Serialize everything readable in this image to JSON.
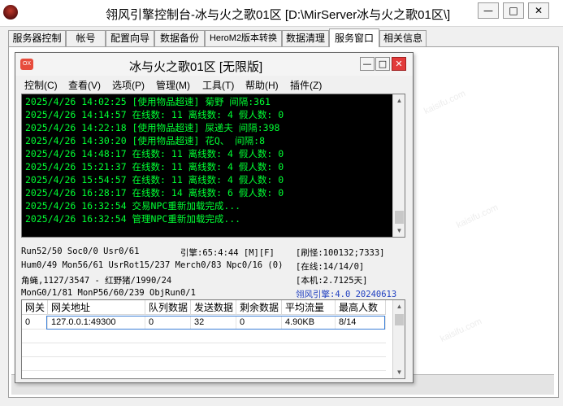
{
  "window": {
    "title": "翎风引擎控制台-冰与火之歌01区 [D:\\MirServer冰与火之歌01区\\]",
    "controls": [
      "—",
      "□",
      "✕"
    ]
  },
  "tabs": [
    {
      "label": "服务器控制",
      "active": false
    },
    {
      "label": "帐号",
      "active": false
    },
    {
      "label": "配置向导",
      "active": false
    },
    {
      "label": "数据备份",
      "active": false
    },
    {
      "label": "HeroM2版本转换",
      "active": false
    },
    {
      "label": "数据清理",
      "active": false
    },
    {
      "label": "服务窗口",
      "active": true
    },
    {
      "label": "相关信息",
      "active": false
    }
  ],
  "inner_window": {
    "icon_text": "OX",
    "title": "冰与火之歌01区 [无限版]",
    "controls": [
      "—",
      "□",
      "✕"
    ],
    "menu": [
      "控制(C)",
      "查看(V)",
      "选项(P)",
      "管理(M)",
      "工具(T)",
      "帮助(H)",
      "插件(Z)"
    ]
  },
  "log": [
    "2025/4/26 14:02:25 [使用物品超速] 菊野 间隔:361",
    "2025/4/26 14:14:57 在线数: 11 离线数: 4 假人数: 0",
    "2025/4/26 14:22:18 [使用物品超速] 屎递夫 间隔:398",
    "2025/4/26 14:30:20 [使用物品超速] 花Q、 间隔:8",
    "2025/4/26 14:48:17 在线数: 11 离线数: 4 假人数: 0",
    "2025/4/26 15:21:37 在线数: 11 离线数: 4 假人数: 0",
    "2025/4/26 15:54:57 在线数: 11 离线数: 4 假人数: 0",
    "2025/4/26 16:28:17 在线数: 14 离线数: 6 假人数: 0",
    "2025/4/26 16:32:54 交易NPC重新加载完成...",
    "2025/4/26 16:32:54 管理NPC重新加载完成..."
  ],
  "status": {
    "line1": "Run52/50 Soc0/0 Usr0/61",
    "line1_mid": "引擎:65:4:44 [M][F]",
    "line1_right": "[刷怪:100132;7333]",
    "line2": "Hum0/49 Mon56/61 UsrRot15/237 Merch0/83 Npc0/16 (0)",
    "line2_right": "[在线:14/14/0]",
    "line3": "角蝇,1127/3547 - 红野猪/1990/24",
    "line3_right": "[本机:2.7125天]",
    "line4": "MonG0/1/81 MonP56/60/239 ObjRun0/1",
    "line4_right": "翎风引擎:4.0 20240613"
  },
  "table": {
    "headers": [
      "网关",
      "网关地址",
      "队列数据",
      "发送数据",
      "剩余数据",
      "平均流量",
      "最高人数"
    ],
    "rows": [
      [
        "0",
        "127.0.0.1:49300",
        "0",
        "32",
        "0",
        "4.90KB",
        "8/14"
      ]
    ]
  },
  "watermark": "kaisifu.com",
  "colors": {
    "log_text": "#00ff33",
    "console_bg": "#000000",
    "accent_blue": "#1f3fc0",
    "close_red": "#e23b3b"
  }
}
